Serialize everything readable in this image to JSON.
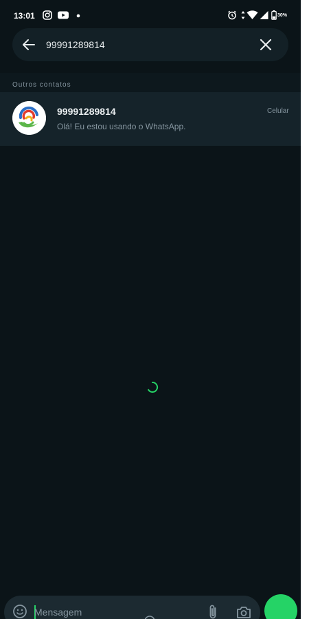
{
  "status_bar": {
    "time": "13:01",
    "battery": "30%",
    "icons": [
      "instagram-icon",
      "youtube-icon",
      "notification-dot-icon",
      "alarm-icon",
      "data-arrows-icon",
      "wifi-icon",
      "signal-icon",
      "battery-icon"
    ]
  },
  "search": {
    "query": "99991289814",
    "back_icon": "arrow-left-icon",
    "clear_icon": "close-icon"
  },
  "results": {
    "section_title": "Outros contatos",
    "contacts": [
      {
        "name": "99991289814",
        "status": "Olá! Eu estou usando o WhatsApp.",
        "type": "Celular"
      }
    ]
  },
  "composer": {
    "placeholder": "Mensagem",
    "icons": [
      "emoji-icon",
      "paperclip-icon",
      "camera-icon"
    ]
  },
  "colors": {
    "background": "#0b1418",
    "accent": "#25d366",
    "search_bg": "#132026",
    "row_bg": "#15232a"
  }
}
